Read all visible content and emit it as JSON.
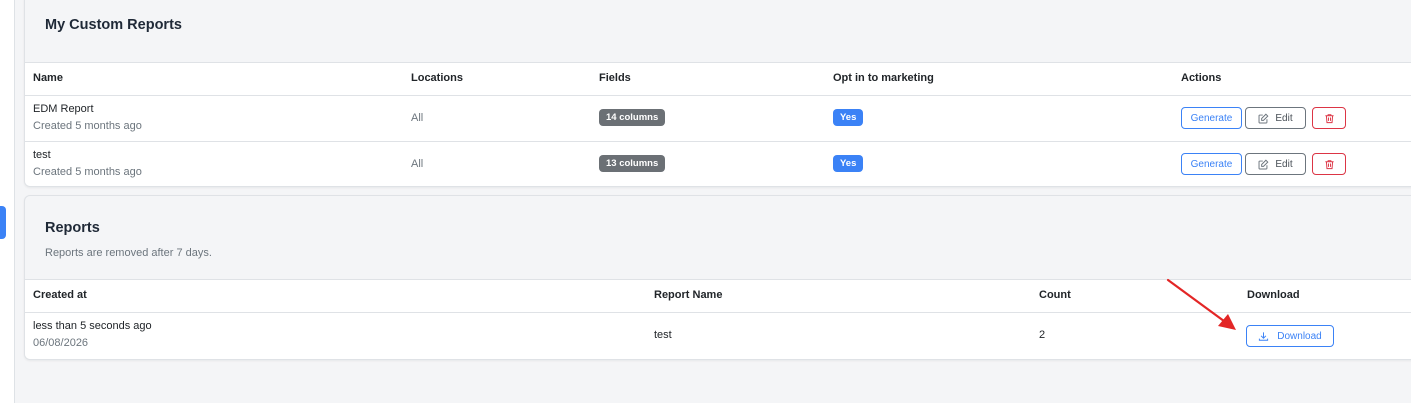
{
  "custom_reports": {
    "title": "My Custom Reports",
    "columns": {
      "name": "Name",
      "locations": "Locations",
      "fields": "Fields",
      "opt_in": "Opt in to marketing",
      "actions": "Actions"
    },
    "rows": [
      {
        "name": "EDM Report",
        "created": "Created 5 months ago",
        "locations": "All",
        "fields": "14 columns",
        "opt_in": "Yes"
      },
      {
        "name": "test",
        "created": "Created 5 months ago",
        "locations": "All",
        "fields": "13 columns",
        "opt_in": "Yes"
      }
    ],
    "actions": {
      "generate": "Generate",
      "edit": "Edit"
    }
  },
  "reports": {
    "title": "Reports",
    "subtitle": "Reports are removed after 7 days.",
    "columns": {
      "created_at": "Created at",
      "report_name": "Report Name",
      "count": "Count",
      "download": "Download"
    },
    "rows": [
      {
        "created_relative": "less than 5 seconds ago",
        "created_date": "06/08/2026",
        "report_name": "test",
        "count": "2",
        "download_label": "Download"
      }
    ]
  },
  "colors": {
    "primary": "#3b82f6",
    "danger": "#dc3545",
    "secondary": "#6b7075",
    "annotation_arrow": "#e32626"
  },
  "icons": {
    "edit": "pencil-square-icon",
    "delete": "trash-icon",
    "download": "download-icon"
  }
}
